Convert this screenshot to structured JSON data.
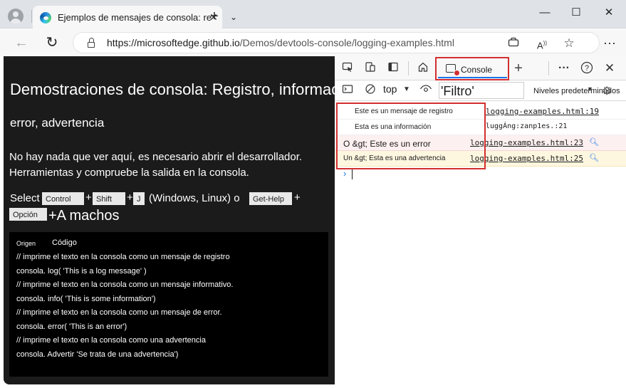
{
  "browser": {
    "tab_title": "Ejemplos de mensajes de consola: registro",
    "tab_close": "✕",
    "new_tab": "+",
    "tab_list": "⌄",
    "url_host": "https://microsoftedge.github.io",
    "url_path": "/Demos/devtools-console/logging-examples.html",
    "window_min": "—",
    "window_max": "☐",
    "window_close": "✕",
    "back": "←",
    "reload": "↻",
    "more": "···"
  },
  "page": {
    "title": "Demostraciones de consola: Registro, informacion",
    "subtitle": "error, advertencia",
    "para_line1": "No hay nada que ver aquí, es necesario abrir el desarrollador.",
    "para_line2": "Herramientas y compruebe la salida en la consola.",
    "select_word": "Select",
    "key_control": "Control",
    "plus": "+",
    "key_shift": "Shift",
    "key_j": "J",
    "os_text": "(Windows, Linux) o",
    "key_gethelp": "Get-Help",
    "key_opcion": "Opción",
    "machos_text": "+A machos",
    "code_header_origin": "Origen",
    "code_header_code": "Código",
    "code_lines": [
      "//   imprime el texto en la consola como un mensaje de registro",
      "consola. log( 'This is a log message' )",
      "//   imprime el texto en la consola como un mensaje informativo.",
      "consola. info( 'This is some information')",
      "//   imprime el texto en la consola como un mensaje de error.",
      "consola. error( 'This is an error')",
      "//   imprime el texto en la consola como una advertencia",
      "consola. Advertir 'Se trata de una advertencia')"
    ]
  },
  "devtools": {
    "console_tab_label": "Console",
    "add_tab": "+",
    "context": "top",
    "filter_value": "'Filtro'",
    "levels": "Niveles predeterminados",
    "messages": [
      {
        "text": "Este es un mensaje de registro",
        "source": "logging-examples.html:19",
        "kind": "log"
      },
      {
        "text": "Esta es una información",
        "source": "luggÁng:zanp1es.:21",
        "kind": "info"
      },
      {
        "text": "O &gt; Este es un error",
        "source": "logging-examples.html:23",
        "kind": "error"
      },
      {
        "text": "Un &gt; Esta es una advertencia",
        "source": "logging-examples.html:25",
        "kind": "warning"
      }
    ],
    "prompt": "›"
  }
}
